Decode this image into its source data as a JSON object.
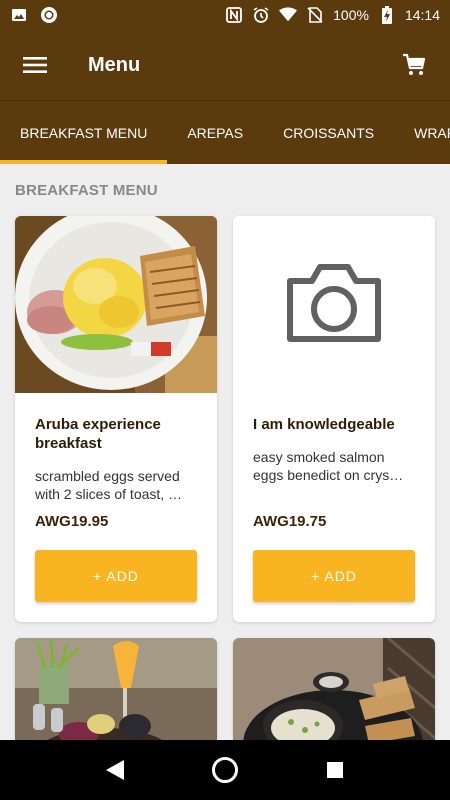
{
  "status_bar": {
    "battery": "100%",
    "time": "14:14",
    "icons": [
      "image-icon",
      "circle-notification-icon",
      "nfc-icon",
      "alarm-icon",
      "wifi-icon",
      "no-sim-icon",
      "battery-charging-icon"
    ]
  },
  "app_bar": {
    "title": "Menu",
    "left_icon": "hamburger-menu-icon",
    "right_icon": "shopping-cart-icon"
  },
  "tabs": [
    {
      "label": "BREAKFAST MENU",
      "active": true
    },
    {
      "label": "AREPAS",
      "active": false
    },
    {
      "label": "CROISSANTS",
      "active": false
    },
    {
      "label": "WRAPS",
      "active": false
    }
  ],
  "section": {
    "title": "BREAKFAST MENU"
  },
  "items": [
    {
      "title": "Aruba experience breakfast",
      "description": "scrambled eggs served with 2 slices of toast, …",
      "price": "AWG19.95",
      "button": "+ ADD"
    },
    {
      "title": "I am knowledgeable",
      "description": "easy smoked salmon eggs benedict on crys…",
      "price": "AWG19.75",
      "button": "+ ADD"
    }
  ],
  "colors": {
    "brand": "#5b3a0e",
    "accent": "#f9b521",
    "background": "#eeeeee"
  }
}
